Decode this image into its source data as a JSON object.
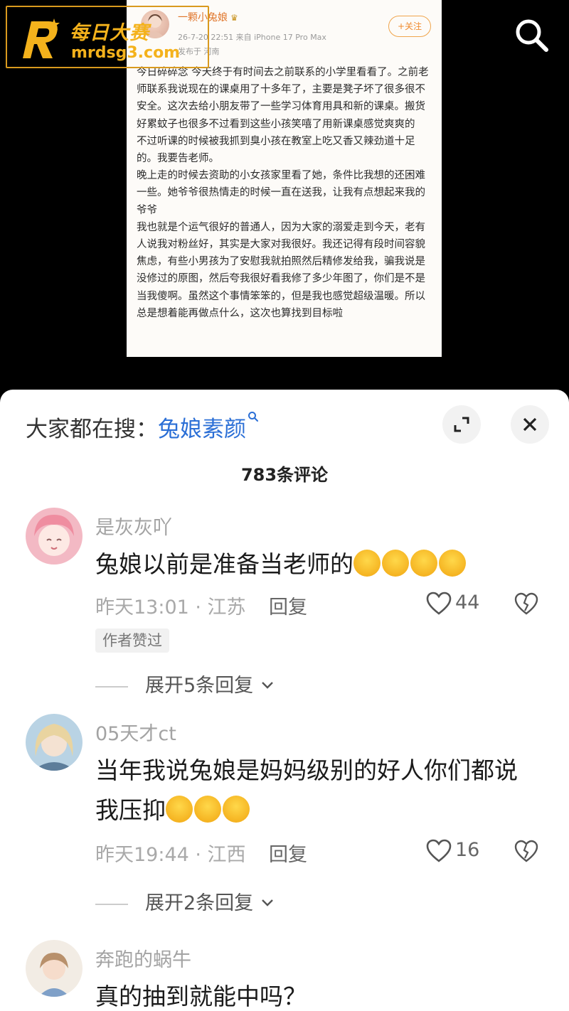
{
  "watermark": {
    "title": "每日大赛",
    "url": "mrdsg3.com"
  },
  "post": {
    "username": "一颗小兔娘",
    "badge": "♛",
    "meta": "26-7-20 22:51  来自 iPhone 17 Pro Max",
    "location": "发布于 河南",
    "follow_label": "+关注",
    "paragraphs": [
      "今日碎碎念 今天终于有时间去之前联系的小学里看看了。之前老师联系我说现在的课桌用了十多年了，主要是凳子坏了很多很不安全。这次去给小朋友带了一些学习体育用具和新的课桌。搬货好累蚊子也很多不过看到这些小孩笑嘻了用新课桌感觉爽爽的",
      "不过听课的时候被我抓到臭小孩在教室上吃又香又辣劲道十足的。我要告老师。",
      "晚上走的时候去资助的小女孩家里看了她，条件比我想的还困难一些。她爷爷很热情走的时候一直在送我，让我有点想起来我的爷爷",
      "我也就是个运气很好的普通人，因为大家的溺爱走到今天，老有人说我对粉丝好，其实是大家对我很好。我还记得有段时间容貌焦虑，有些小男孩为了安慰我就拍照然后精修发给我，骗我说是没修过的原图，然后夸我很好看我修了多少年图了，你们是不是当我傻啊。虽然这个事情笨笨的，但是我也感觉超级温暖。所以总是想着能再做点什么，这次也算找到目标啦"
    ]
  },
  "panel": {
    "search_prefix": "大家都在搜：",
    "search_term": "兔娘素颜",
    "comment_count": "783条评论"
  },
  "comments": [
    {
      "name": "是灰灰吖",
      "text": "兔娘以前是准备当老师的",
      "emoji_count": 4,
      "time_location": "昨天13:01 · 江苏",
      "reply_label": "回复",
      "likes": "44",
      "author_tag": "作者赞过",
      "expand_label": "展开5条回复"
    },
    {
      "name": "05天才ct",
      "text_line1": "当年我说兔娘是妈妈级别的好人你们都说",
      "text_line2": "我压抑",
      "emoji_count": 3,
      "time_location": "昨天19:44 · 江西",
      "reply_label": "回复",
      "likes": "16",
      "expand_label": "展开2条回复"
    },
    {
      "name": "奔跑的蜗牛",
      "text": "真的抽到就能中吗？"
    }
  ],
  "icons": {
    "top_search": "search-icon",
    "expand": "expand-icon",
    "close": "close-icon",
    "like": "heart-icon",
    "dislike": "broken-heart-icon",
    "chevron": "chevron-down-icon"
  },
  "colors": {
    "watermark": "#f4b21c",
    "link_blue": "#2b6fd6",
    "follow_orange": "#f08a2c"
  }
}
